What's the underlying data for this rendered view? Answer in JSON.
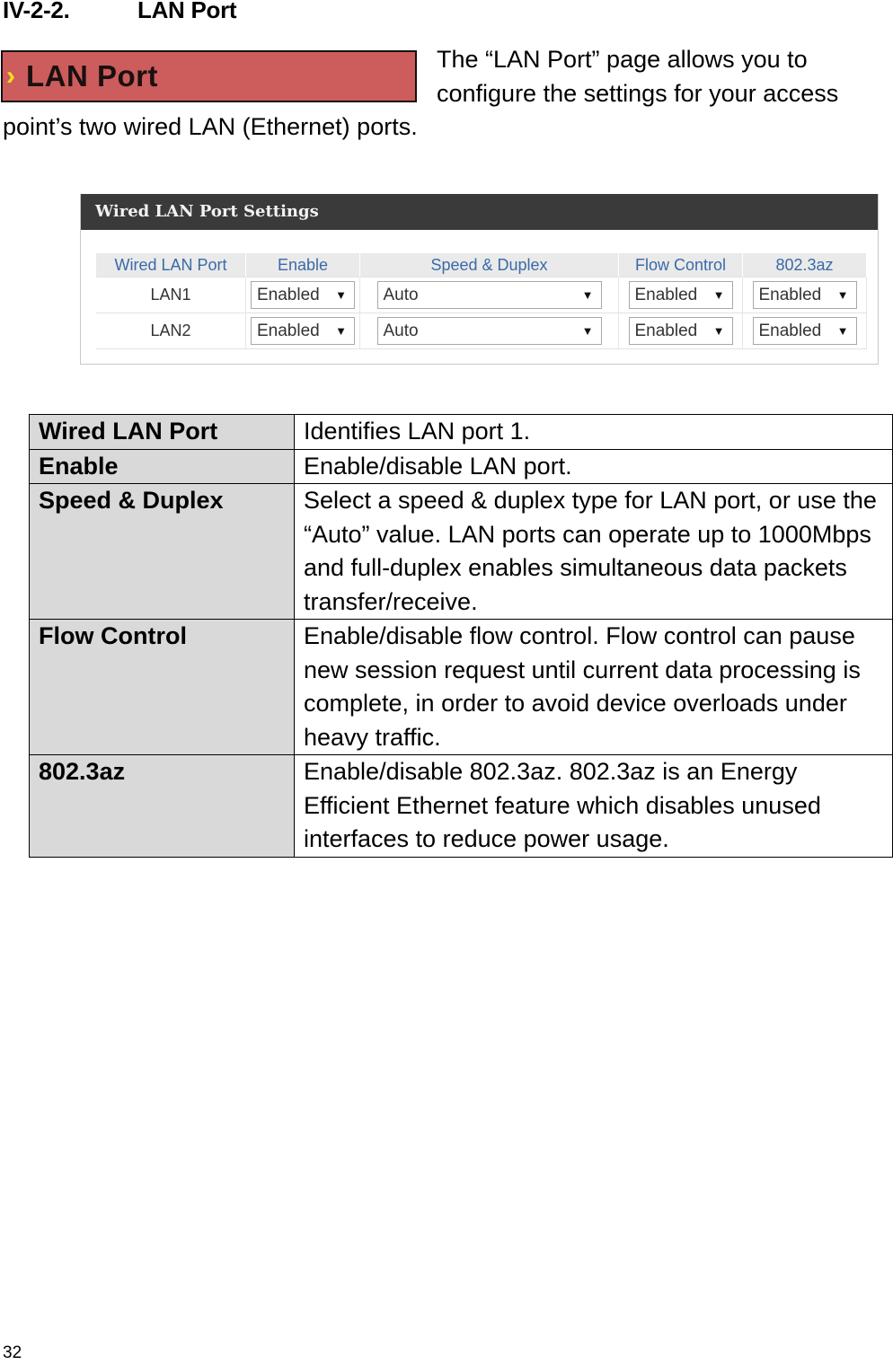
{
  "section": {
    "number": "IV-2-2.",
    "title": "LAN Port"
  },
  "banner": {
    "icon": "chevron-right-icon",
    "title": "LAN Port"
  },
  "intro": "The “LAN Port” page allows you to configure the settings for your access point’s two wired LAN (Ethernet) ports.",
  "panel": {
    "title": "Wired LAN Port Settings",
    "columns": [
      "Wired LAN Port",
      "Enable",
      "Speed & Duplex",
      "Flow Control",
      "802.3az"
    ],
    "rows": [
      {
        "port": "LAN1",
        "enable": "Enabled",
        "speed": "Auto",
        "flow": "Enabled",
        "az": "Enabled"
      },
      {
        "port": "LAN2",
        "enable": "Enabled",
        "speed": "Auto",
        "flow": "Enabled",
        "az": "Enabled"
      }
    ],
    "dropdown_icon": "dropdown-arrow-icon"
  },
  "description_table": [
    {
      "key": "Wired LAN Port",
      "value": "Identifies LAN port 1."
    },
    {
      "key": "Enable",
      "value": "Enable/disable LAN port."
    },
    {
      "key": "Speed & Duplex",
      "value": "Select a speed & duplex type for LAN port, or use the “Auto” value. LAN ports can operate up to 1000Mbps and full-duplex enables simultaneous data packets transfer/receive."
    },
    {
      "key": "Flow Control",
      "value": "Enable/disable flow control. Flow control can pause new session request until current data processing is complete, in order to avoid device overloads under heavy traffic."
    },
    {
      "key": "802.3az",
      "value": "Enable/disable 802.3az. 802.3az is an Energy Efficient Ethernet feature which disables unused interfaces to reduce power usage."
    }
  ],
  "page_number": "32",
  "colors": {
    "banner": "#cd5c5c",
    "chevron": "#f2e21a",
    "panel_header": "#3a3a3a",
    "column_header_text": "#3a6aa8",
    "key_cell": "#d9d9d9"
  }
}
